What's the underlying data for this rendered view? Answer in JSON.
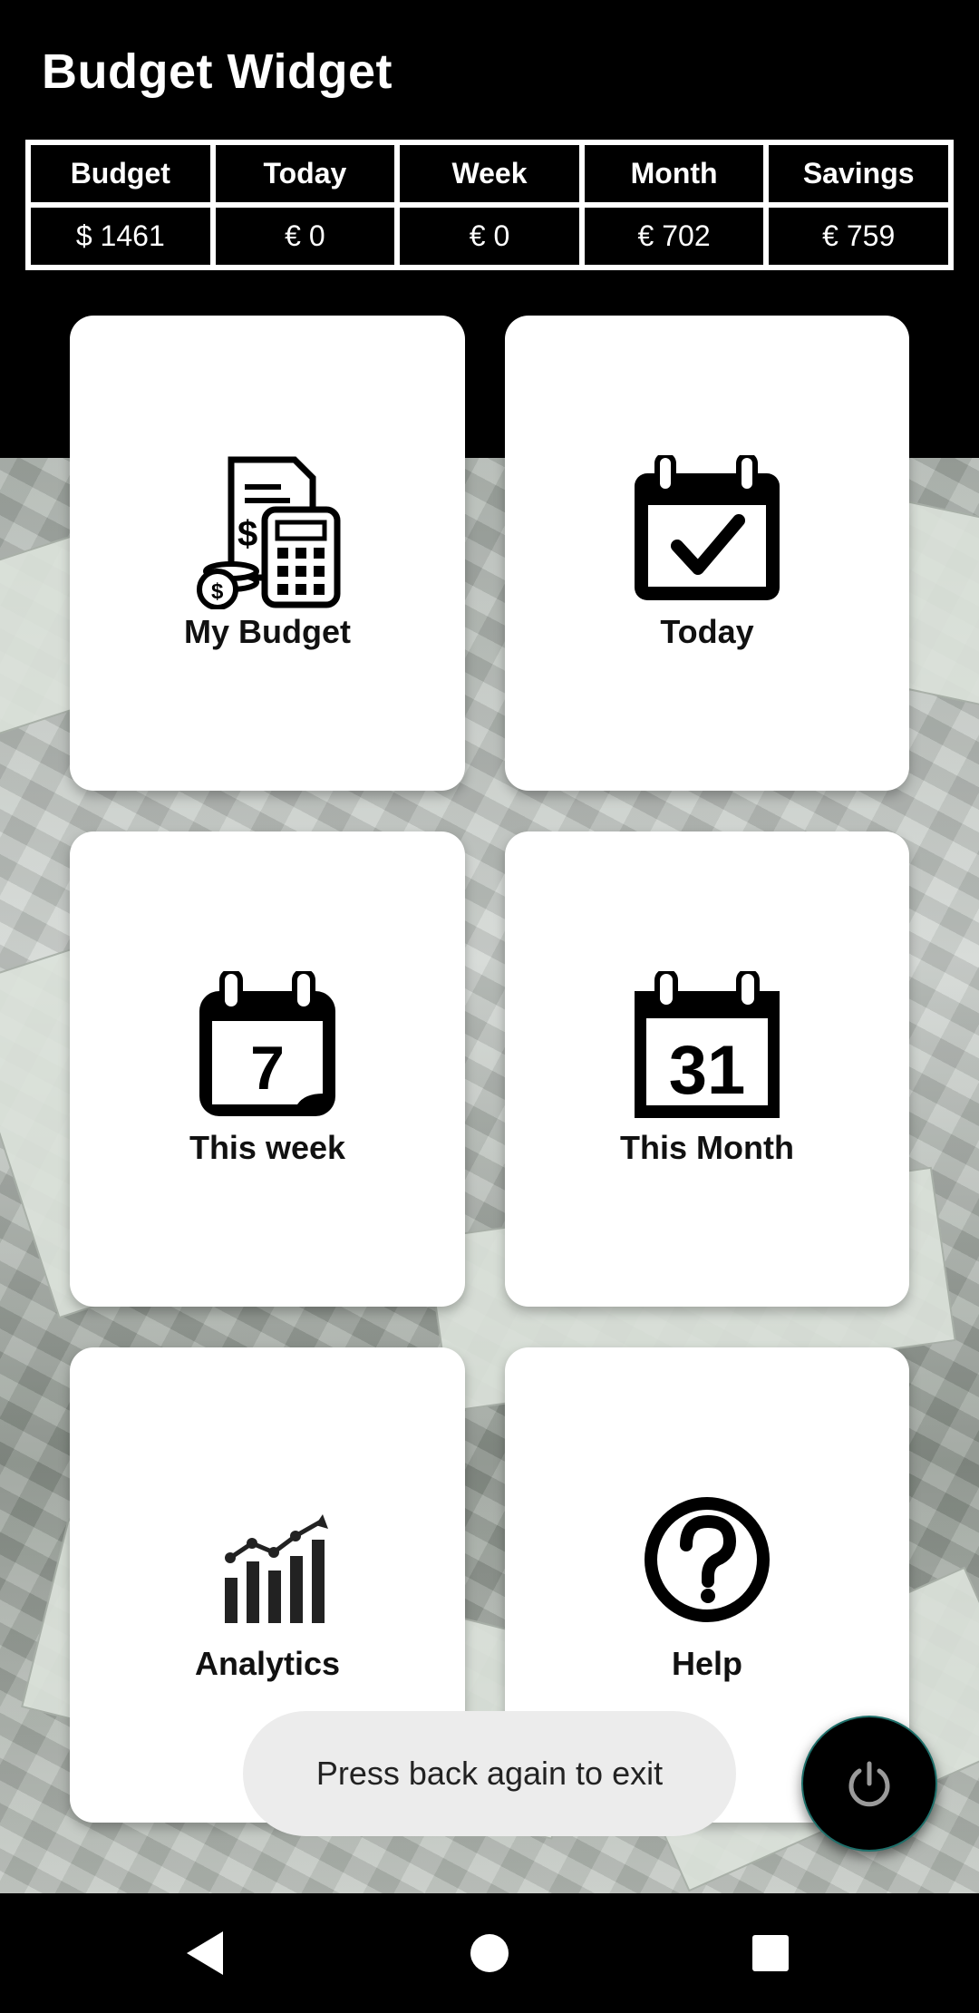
{
  "app": {
    "title": "Budget Widget"
  },
  "summary": {
    "headers": [
      "Budget",
      "Today",
      "Week",
      "Month",
      "Savings"
    ],
    "values": [
      "$ 1461",
      "€ 0",
      "€ 0",
      "€ 702",
      "€ 759"
    ]
  },
  "tiles": [
    {
      "label": "My Budget",
      "icon": "budget-calculator-icon"
    },
    {
      "label": "Today",
      "icon": "calendar-check-icon"
    },
    {
      "label": "This week",
      "icon": "calendar-week-icon",
      "icon_text": "7"
    },
    {
      "label": "This Month",
      "icon": "calendar-month-icon",
      "icon_text": "31"
    },
    {
      "label": "Analytics",
      "icon": "analytics-chart-icon"
    },
    {
      "label": "Help",
      "icon": "help-question-icon"
    }
  ],
  "toast": {
    "message": "Press back again to exit"
  },
  "fab": {
    "icon": "power-icon"
  },
  "navigation": {
    "back": "back-icon",
    "home": "home-icon",
    "recents": "recents-icon"
  },
  "colors": {
    "background": "#000000",
    "tile": "#ffffff",
    "toast": "#ececec",
    "fab_border": "#1e6f6a"
  }
}
